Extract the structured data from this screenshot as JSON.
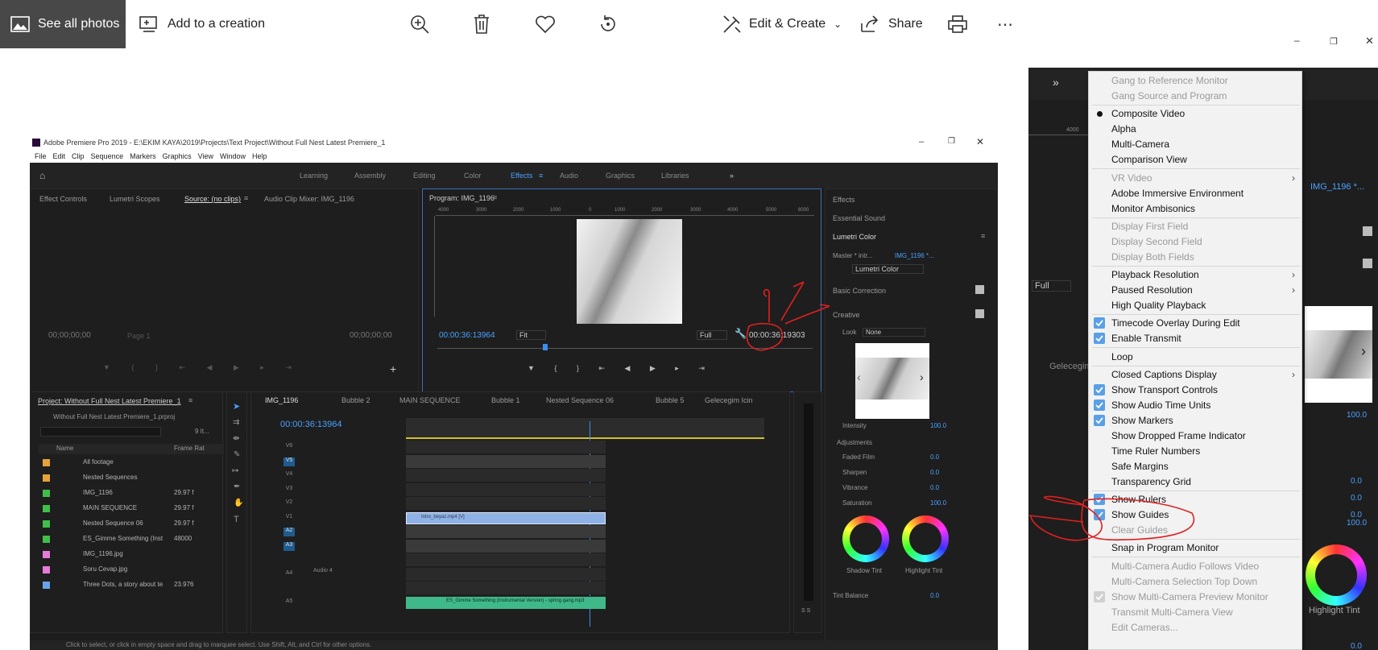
{
  "photos_toolbar": {
    "see_all": "See all photos",
    "add_to_creation": "Add to a creation",
    "edit_create": "Edit & Create",
    "share": "Share"
  },
  "premiere": {
    "title": "Adobe Premiere Pro 2019 - E:\\EKIM KAYA\\2019\\Projects\\Text Project\\Without Full Nest Latest Premiere_1",
    "menu": [
      "File",
      "Edit",
      "Clip",
      "Sequence",
      "Markers",
      "Graphics",
      "View",
      "Window",
      "Help"
    ],
    "workspaces": [
      "Learning",
      "Assembly",
      "Editing",
      "Color",
      "Effects",
      "Audio",
      "Graphics",
      "Libraries"
    ],
    "source_tabs": [
      "Effect Controls",
      "Lumetri Scopes",
      "Source: (no clips)",
      "Audio Clip Mixer: IMG_1196"
    ],
    "source_tc_left": "00;00;00;00",
    "source_tc_right": "00;00;00;00",
    "source_page": "Page 1",
    "program_title": "Program: IMG_1196",
    "program_tc": "00:00:36:13964",
    "program_tc_end": "00:00:36:19303",
    "fit": "Fit",
    "full": "Full",
    "ruler_labels": [
      "4000",
      "3000",
      "2000",
      "1000",
      "0",
      "1000",
      "2000",
      "3000",
      "4000",
      "5000",
      "6000"
    ],
    "right_panel": {
      "effects": "Effects",
      "essential_sound": "Essential Sound",
      "lumetri": "Lumetri Color",
      "master": "Master * intr...",
      "clip": "IMG_1196 *...",
      "fx_label": "Lumetri Color",
      "basic": "Basic Correction",
      "creative": "Creative",
      "look_label": "Look",
      "look_value": "None",
      "intensity": "Intensity",
      "intensity_val": "100.0",
      "adjustments": "Adjustments",
      "adj": [
        {
          "label": "Faded Film",
          "value": "0.0"
        },
        {
          "label": "Sharpen",
          "value": "0.0"
        },
        {
          "label": "Vibrance",
          "value": "0.0"
        },
        {
          "label": "Saturation",
          "value": "100.0"
        }
      ],
      "shadow_tint": "Shadow Tint",
      "highlight_tint": "Highlight Tint",
      "tint_balance": "Tint Balance",
      "tint_balance_val": "0.0"
    },
    "project": {
      "title": "Project: Without Full Nest Latest Premiere_1",
      "file": "Without Full Nest Latest Premiere_1.prproj",
      "items_count": "9 It...",
      "col_name": "Name",
      "col_rate": "Frame Rat",
      "rows": [
        {
          "name": "All footage",
          "rate": "",
          "color": "#e8a23a"
        },
        {
          "name": "Nested Sequences",
          "rate": "",
          "color": "#e8a23a"
        },
        {
          "name": "IMG_1196",
          "rate": "29.97 f",
          "color": "#3fbf4a"
        },
        {
          "name": "MAIN SEQUENCE",
          "rate": "29.97 f",
          "color": "#3fbf4a"
        },
        {
          "name": "Nested Sequence 06",
          "rate": "29.97 f",
          "color": "#3fbf4a"
        },
        {
          "name": "ES_Gimme Something (Inst",
          "rate": "48000",
          "color": "#3fbf4a"
        },
        {
          "name": "IMG_1196.jpg",
          "rate": "",
          "color": "#e87ad8"
        },
        {
          "name": "Soru Cevap.jpg",
          "rate": "",
          "color": "#e87ad8"
        },
        {
          "name": "Three Dots, a story about te",
          "rate": "23.976",
          "color": "#6aa4e8"
        }
      ]
    },
    "timeline": {
      "tabs": [
        "IMG_1196",
        "Bubble 2",
        "MAIN SEQUENCE",
        "Bubble 1",
        "Nested Sequence 06",
        "Bubble 5",
        "Gelecegim Icin"
      ],
      "tc": "00:00:36:13964",
      "tracks": [
        "V6",
        "V5",
        "V4",
        "V3",
        "V2",
        "V1",
        "A2",
        "A3",
        "",
        "A4",
        "",
        "A5"
      ],
      "audio4": "Audio 4",
      "clip_video": "Intro_beyaz.mp4 [V]",
      "clip_audio": "ES_Gimme Something (Instrumental Version) - spring gang.mp3"
    },
    "meter_label": "S S",
    "status": "Click to select, or click in empty space and drag to marquee select. Use Shift, Alt, and Ctrl for other options."
  },
  "right_premiere": {
    "clip": "IMG_1196 *...",
    "full": "Full",
    "ruler": "4000",
    "gelecegim": "Gelecegim",
    "values": [
      "100.0",
      "0.0",
      "0.0",
      "0.0",
      "100.0"
    ],
    "highlight_tint": "Highlight Tint",
    "last": "0.0"
  },
  "context_menu": {
    "items": [
      {
        "label": "Gang to Reference Monitor",
        "state": "disabled"
      },
      {
        "label": "Gang Source and Program",
        "state": "disabled"
      },
      {
        "sep": true
      },
      {
        "label": "Composite Video",
        "state": "radio"
      },
      {
        "label": "Alpha",
        "state": "normal"
      },
      {
        "label": "Multi-Camera",
        "state": "normal"
      },
      {
        "label": "Comparison View",
        "state": "normal"
      },
      {
        "sep": true
      },
      {
        "label": "VR Video",
        "state": "disabled",
        "submenu": true
      },
      {
        "label": "Adobe Immersive Environment",
        "state": "normal"
      },
      {
        "label": "Monitor Ambisonics",
        "state": "normal"
      },
      {
        "sep": true
      },
      {
        "label": "Display First Field",
        "state": "disabled"
      },
      {
        "label": "Display Second Field",
        "state": "disabled"
      },
      {
        "label": "Display Both Fields",
        "state": "disabled"
      },
      {
        "sep": true
      },
      {
        "label": "Playback Resolution",
        "state": "normal",
        "submenu": true
      },
      {
        "label": "Paused Resolution",
        "state": "normal",
        "submenu": true
      },
      {
        "label": "High Quality Playback",
        "state": "normal"
      },
      {
        "sep": true
      },
      {
        "label": "Timecode Overlay During Edit",
        "state": "checked"
      },
      {
        "label": "Enable Transmit",
        "state": "checked"
      },
      {
        "sep": true
      },
      {
        "label": "Loop",
        "state": "normal"
      },
      {
        "sep": true
      },
      {
        "label": "Closed Captions Display",
        "state": "normal",
        "submenu": true
      },
      {
        "label": "Show Transport Controls",
        "state": "checked"
      },
      {
        "label": "Show Audio Time Units",
        "state": "checked"
      },
      {
        "label": "Show Markers",
        "state": "checked"
      },
      {
        "label": "Show Dropped Frame Indicator",
        "state": "normal"
      },
      {
        "label": "Time Ruler Numbers",
        "state": "normal"
      },
      {
        "label": "Safe Margins",
        "state": "normal"
      },
      {
        "label": "Transparency Grid",
        "state": "normal"
      },
      {
        "sep": true
      },
      {
        "label": "Show Rulers",
        "state": "checked"
      },
      {
        "label": "Show Guides",
        "state": "checked"
      },
      {
        "label": "Clear Guides",
        "state": "disabled"
      },
      {
        "sep": true
      },
      {
        "label": "Snap in Program Monitor",
        "state": "normal"
      },
      {
        "sep": true
      },
      {
        "label": "Multi-Camera Audio Follows Video",
        "state": "disabled"
      },
      {
        "label": "Multi-Camera Selection Top Down",
        "state": "disabled"
      },
      {
        "label": "Show Multi-Camera Preview Monitor",
        "state": "disabled-checked"
      },
      {
        "label": "Transmit Multi-Camera View",
        "state": "disabled"
      },
      {
        "label": "Edit Cameras...",
        "state": "disabled"
      }
    ]
  },
  "colors": {
    "accent": "#4aa0ff",
    "menu_check": "#5aa0e6",
    "annotation": "#e02020"
  }
}
